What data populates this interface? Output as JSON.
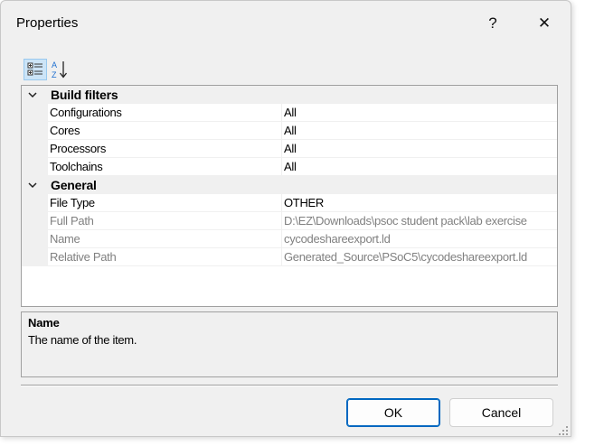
{
  "window": {
    "title": "Properties",
    "help_label": "?",
    "close_label": "✕"
  },
  "toolbar": {
    "categorized_icon": "categorized-view-icon",
    "alphabetical_icon": "sort-alphabetical-icon",
    "categorized_active": true
  },
  "grid": {
    "categories": [
      {
        "label": "Build filters",
        "expanded": true,
        "rows": [
          {
            "name": "Configurations",
            "value": "All",
            "readonly": false
          },
          {
            "name": "Cores",
            "value": "All",
            "readonly": false
          },
          {
            "name": "Processors",
            "value": "All",
            "readonly": false
          },
          {
            "name": "Toolchains",
            "value": "All",
            "readonly": false
          }
        ]
      },
      {
        "label": "General",
        "expanded": true,
        "rows": [
          {
            "name": "File Type",
            "value": "OTHER",
            "readonly": false
          },
          {
            "name": "Full Path",
            "value": "D:\\EZ\\Downloads\\psoc student pack\\lab exercise",
            "readonly": true
          },
          {
            "name": "Name",
            "value": "cycodeshareexport.ld",
            "readonly": true
          },
          {
            "name": "Relative Path",
            "value": "Generated_Source\\PSoC5\\cycodeshareexport.ld",
            "readonly": true
          }
        ]
      }
    ]
  },
  "description": {
    "title": "Name",
    "text": "The name of the item."
  },
  "buttons": {
    "ok_label": "OK",
    "cancel_label": "Cancel"
  },
  "colors": {
    "dialog_bg": "#f0f0f0",
    "readonly_text": "#808080",
    "default_button_border": "#0067c0",
    "toolbar_active_bg": "#cce4f7"
  }
}
